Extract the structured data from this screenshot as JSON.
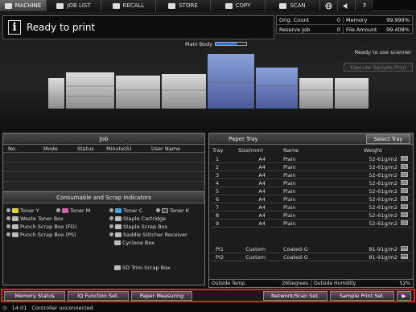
{
  "tabs": [
    {
      "label": "MACHINE",
      "icon": "machine-icon"
    },
    {
      "label": "JOB LIST",
      "icon": "list-icon"
    },
    {
      "label": "RECALL",
      "icon": "recall-icon"
    },
    {
      "label": "STORE",
      "icon": "store-icon"
    },
    {
      "label": "COPY",
      "icon": "copy-icon"
    },
    {
      "label": "SCAN",
      "icon": "scan-icon"
    }
  ],
  "status": {
    "message": "Ready to print"
  },
  "counts": {
    "orig_label": "Orig. Count",
    "orig_value": "0",
    "memory_label": "Memory",
    "memory_value": "99.999%",
    "reserve_label": "Reserve Job",
    "reserve_value": "0",
    "file_label": "File Amount",
    "file_value": "99.408%"
  },
  "main_body": {
    "label": "Main Body",
    "level": 0.7
  },
  "scanner_status": "Ready to use scanner",
  "execute_sample": "Execute Sample Print",
  "job": {
    "title": "Job",
    "columns": [
      "No.",
      "Mode",
      "Status",
      "Minute(S)",
      "User Name"
    ]
  },
  "consumables": {
    "title": "Consumable and Scrap Indicators",
    "items": [
      "Toner Y",
      "Toner M",
      "Toner C",
      "Toner K",
      "Waste Toner Box",
      "Staple Cartridge",
      "Punch Scrap Box (FD)",
      "Staple Scrap Box",
      "Punch Scrap Box (PS)",
      "Saddle Stitcher Receiver",
      "Cyclone Box",
      "SD Trim Scrap Box"
    ]
  },
  "paper_tray": {
    "title": "Paper Tray",
    "select_label": "Select Tray",
    "columns": [
      "Tray",
      "Size(mm)",
      "Name",
      "Weight"
    ],
    "rows": [
      {
        "tray": "1",
        "size": "A4",
        "name": "Plain",
        "weight": "52-61g/m2"
      },
      {
        "tray": "2",
        "size": "A4",
        "name": "Plain",
        "weight": "52-61g/m2"
      },
      {
        "tray": "3",
        "size": "A4",
        "name": "Plain",
        "weight": "52-61g/m2"
      },
      {
        "tray": "4",
        "size": "A4",
        "name": "Plain",
        "weight": "52-61g/m2"
      },
      {
        "tray": "5",
        "size": "A4",
        "name": "Plain",
        "weight": "52-61g/m2"
      },
      {
        "tray": "6",
        "size": "A4",
        "name": "Plain",
        "weight": "52-61g/m2"
      },
      {
        "tray": "7",
        "size": "A4",
        "name": "Plain",
        "weight": "52-61g/m2"
      },
      {
        "tray": "8",
        "size": "A4",
        "name": "Plain",
        "weight": "52-61g/m2"
      },
      {
        "tray": "9",
        "size": "A4",
        "name": "Plain",
        "weight": "52-61g/m2"
      }
    ],
    "pi_rows": [
      {
        "tray": "PI1",
        "size": "Custom",
        "name": "Coated-G",
        "weight": "81-91g/m2"
      },
      {
        "tray": "PI2",
        "size": "Custom",
        "name": "Coated-G",
        "weight": "81-91g/m2"
      }
    ],
    "outside_temp_label": "Outside Temp.",
    "outside_temp_value": "26Degrees",
    "outside_humidity_label": "Outside Humidity",
    "outside_humidity_value": "52%"
  },
  "buttons": [
    "Memory Status",
    "IQ Function Set.",
    "Paper Measuring",
    "Network/Scan Set.",
    "Sample Print Set."
  ],
  "statusbar": {
    "time": "14:01",
    "controller": "Controller unconnected"
  }
}
